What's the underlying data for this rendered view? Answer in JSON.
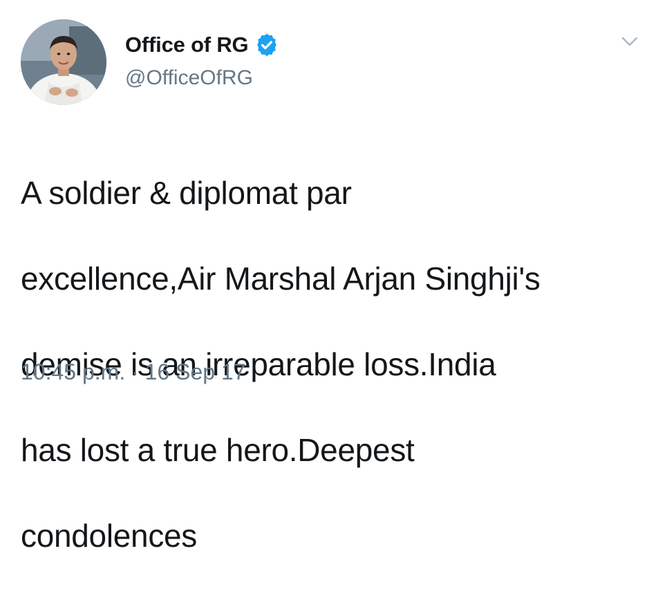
{
  "tweet": {
    "display_name": "Office of RG",
    "handle": "@OfficeOfRG",
    "text_lines": [
      "A soldier & diplomat par",
      "excellence,Air Marshal Arjan Singhji's",
      "demise is an irreparable loss.India",
      "has lost a true hero.Deepest",
      "condolences"
    ],
    "timestamp": "10:45 p.m. · 16 Sep 17",
    "verified": true
  },
  "icons": {
    "verified": "verified-badge-icon",
    "menu": "chevron-down-icon",
    "avatar": "profile-photo"
  },
  "colors": {
    "verified_blue": "#1da1f2",
    "secondary_text": "#657786",
    "primary_text": "#14171a"
  }
}
